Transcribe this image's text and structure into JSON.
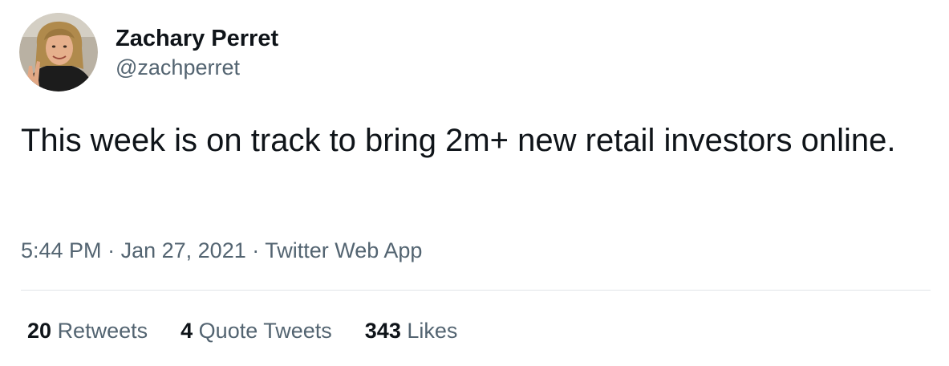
{
  "author": {
    "display_name": "Zachary Perret",
    "handle": "@zachperret",
    "avatar_icon": "user-avatar"
  },
  "tweet": {
    "text": "This week is on track to bring 2m+ new retail investors online."
  },
  "meta": {
    "time": "5:44 PM",
    "separator": "·",
    "date": "Jan 27, 2021",
    "source": "Twitter Web App"
  },
  "stats": {
    "retweets_count": "20",
    "retweets_label": "Retweets",
    "quotes_count": "4",
    "quotes_label": "Quote Tweets",
    "likes_count": "343",
    "likes_label": "Likes"
  },
  "colors": {
    "primary_text": "#0f1419",
    "secondary_text": "#536471",
    "divider": "#e1e5e8"
  }
}
